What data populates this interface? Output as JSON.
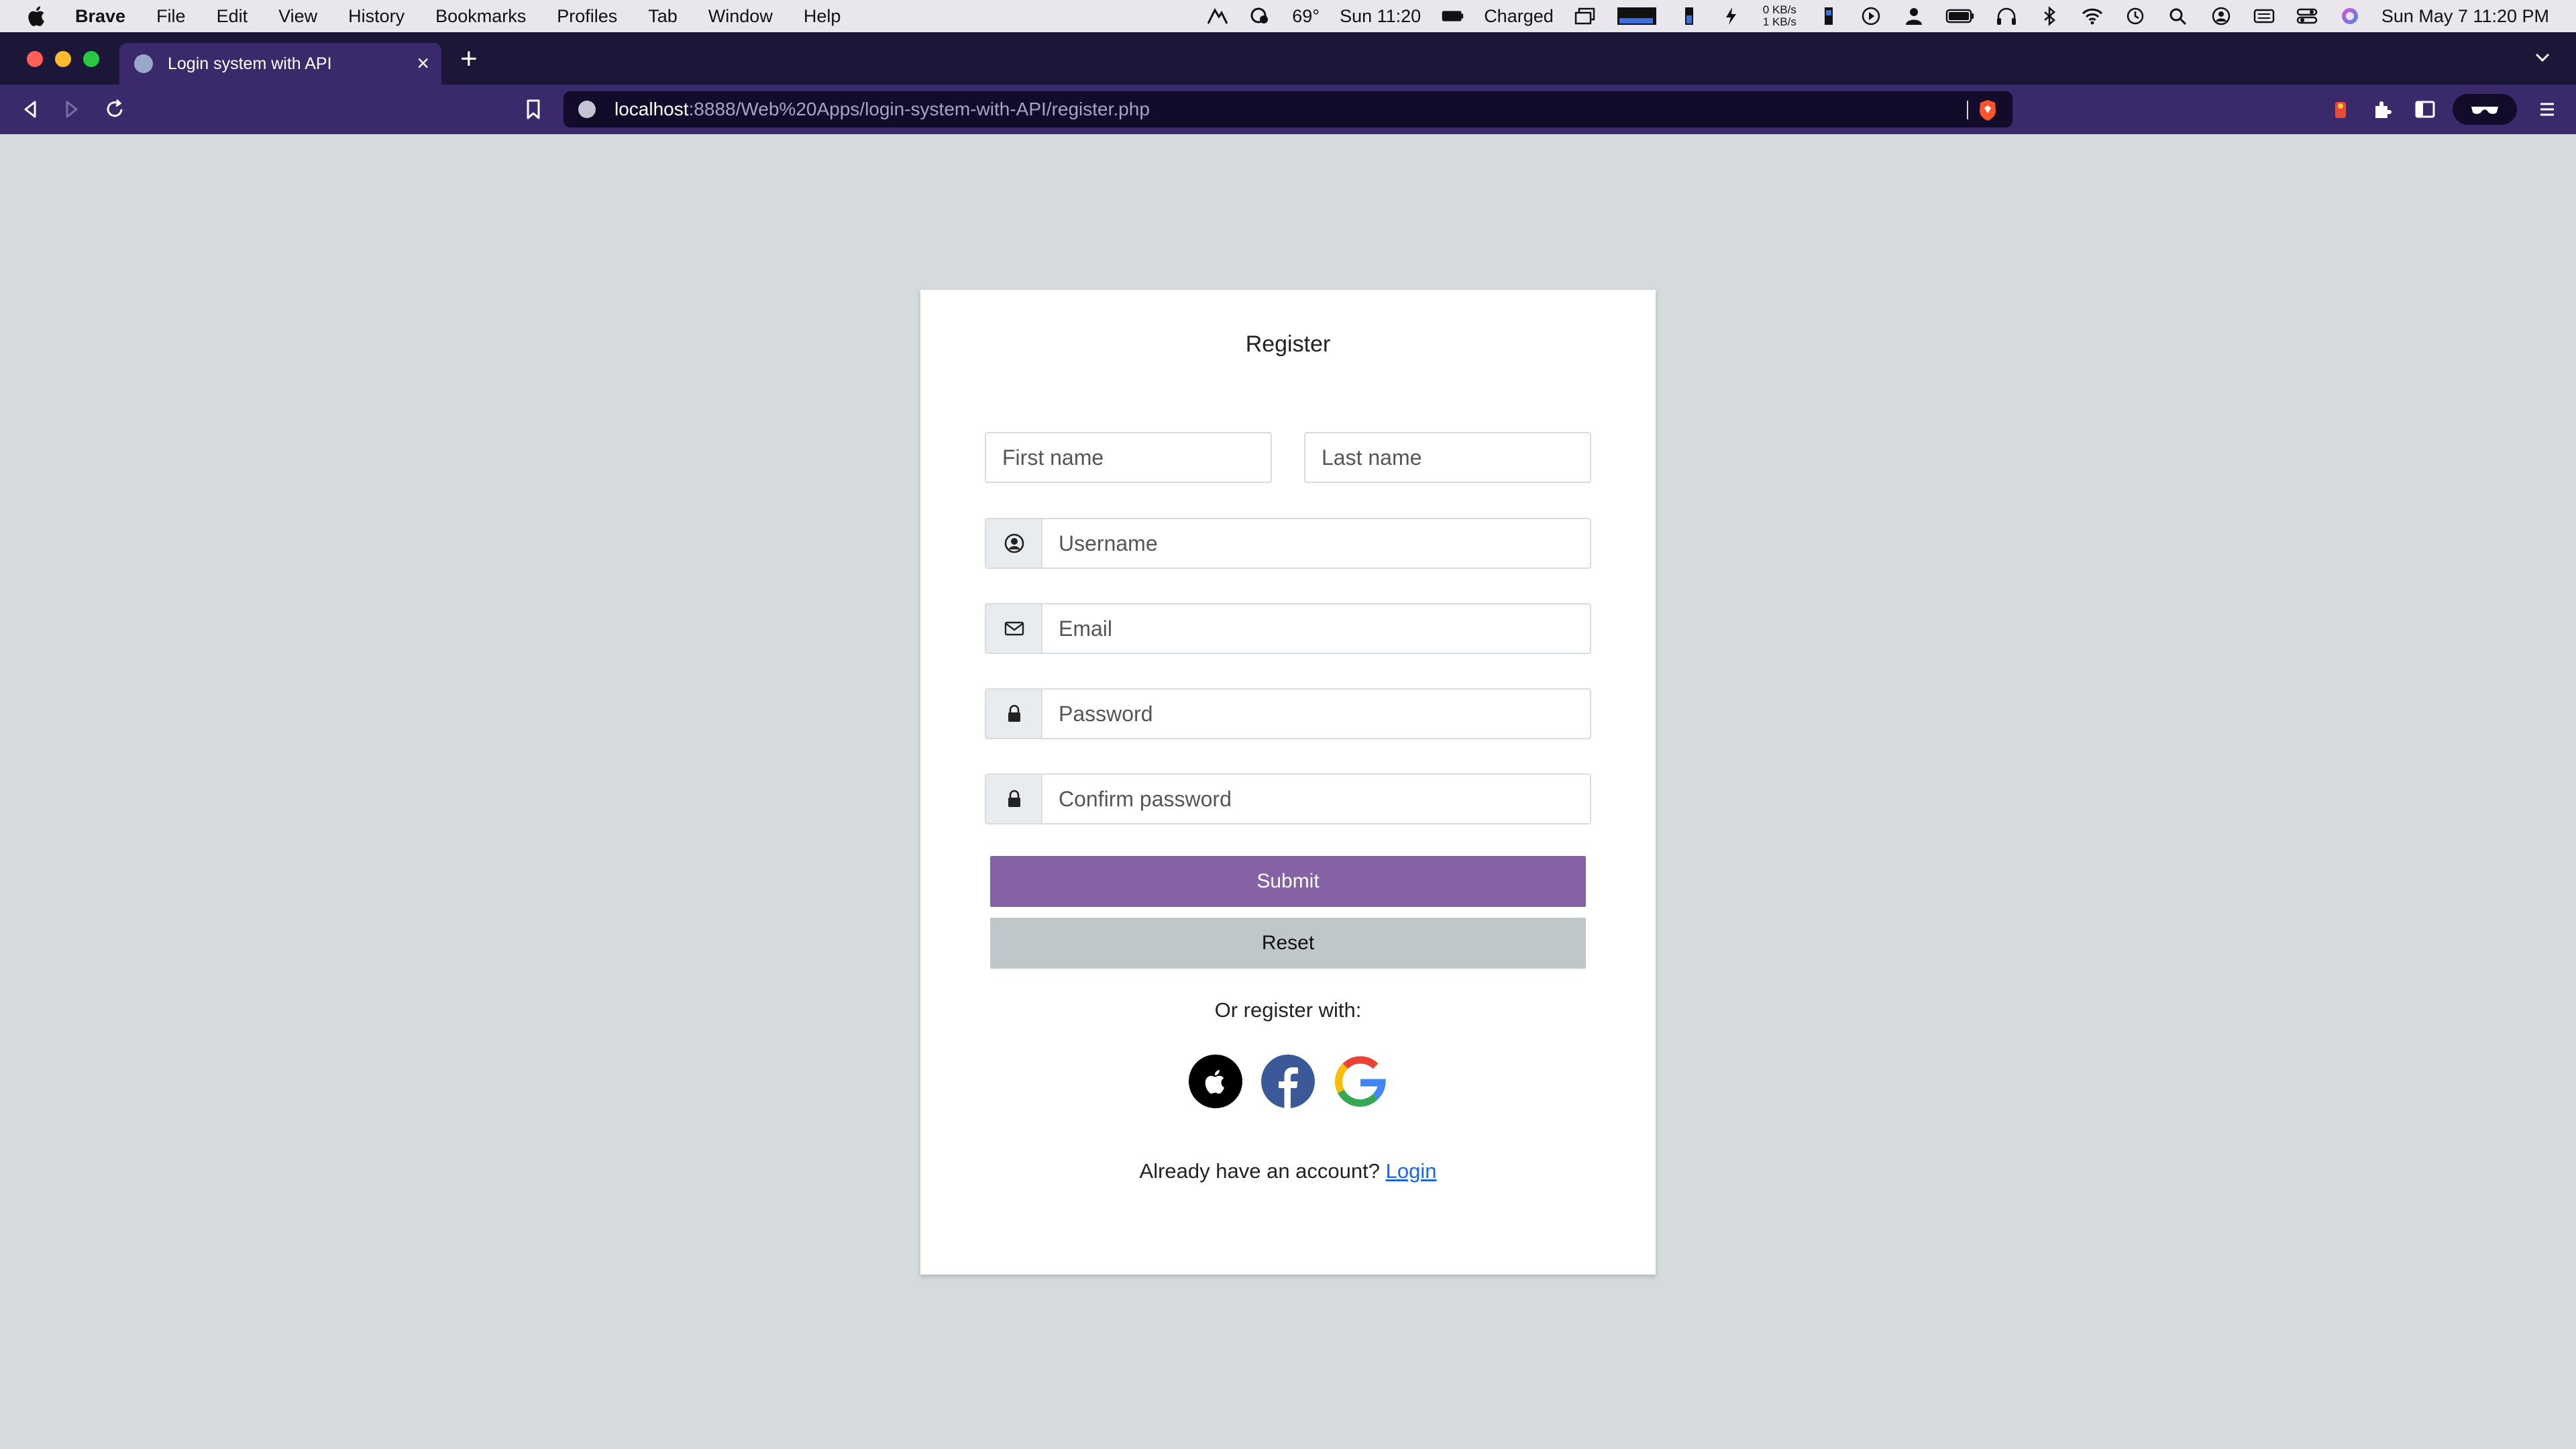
{
  "menubar": {
    "app": "Brave",
    "items": [
      "File",
      "Edit",
      "View",
      "History",
      "Bookmarks",
      "Profiles",
      "Tab",
      "Window",
      "Help"
    ],
    "weather": "69°",
    "time_short": "Sun 11:20",
    "battery_status": "Charged",
    "net_up": "0 KB/s",
    "net_down": "1 KB/s",
    "datetime": "Sun May 7  11:20 PM"
  },
  "browser": {
    "tab_title": "Login system with API",
    "url_host": "localhost",
    "url_path": ":8888/Web%20Apps/login-system-with-API/register.php"
  },
  "form": {
    "title": "Register",
    "first_name_placeholder": "First name",
    "last_name_placeholder": "Last name",
    "username_placeholder": "Username",
    "email_placeholder": "Email",
    "password_placeholder": "Password",
    "confirm_password_placeholder": "Confirm password",
    "submit_label": "Submit",
    "reset_label": "Reset",
    "or_register": "Or register with:",
    "already_text": "Already have an account?",
    "login_link": "Login"
  },
  "colors": {
    "primary": "#8462a4",
    "secondary": "#bfc7ca",
    "background": "#d5dbdc",
    "link": "#1a66e6",
    "browser_chrome": "#3a2a6b",
    "facebook": "#3b5998"
  },
  "icons": {
    "username_addon": "user-circle-icon",
    "email_addon": "envelope-icon",
    "password_addon": "lock-icon",
    "social": [
      "apple-icon",
      "facebook-icon",
      "google-icon"
    ]
  }
}
